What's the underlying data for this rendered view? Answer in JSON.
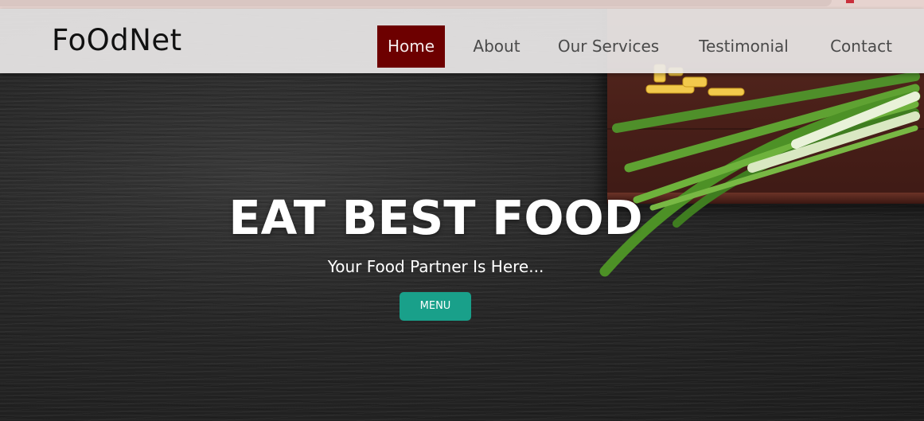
{
  "brand": {
    "name": "FoOdNet"
  },
  "nav": {
    "items": [
      {
        "label": "Home",
        "active": true
      },
      {
        "label": "About",
        "active": false
      },
      {
        "label": "Our Services",
        "active": false
      },
      {
        "label": "Testimonial",
        "active": false
      },
      {
        "label": "Contact",
        "active": false
      }
    ]
  },
  "hero": {
    "headline": "EAT BEST FOOD",
    "subheadline": "Your Food Partner Is Here...",
    "cta_label": "MENU"
  },
  "colors": {
    "nav_active_bg": "#6d0000",
    "cta_bg": "#19a08a",
    "navbar_bg": "#ece9e9",
    "hero_bg": "#262626"
  }
}
